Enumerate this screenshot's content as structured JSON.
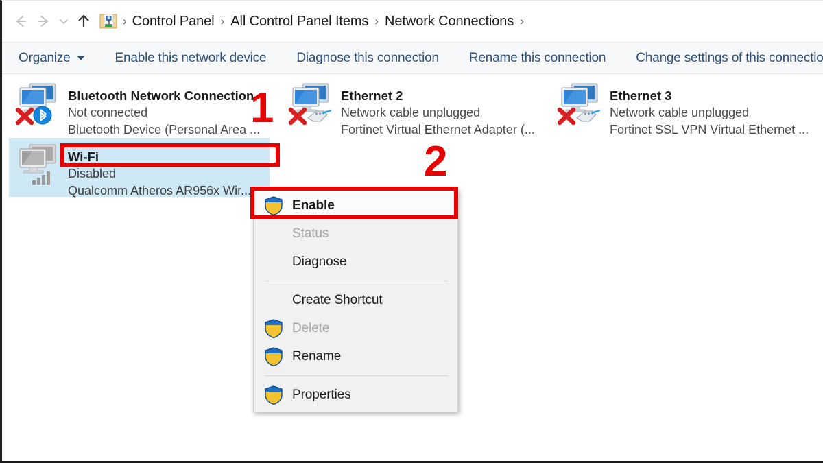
{
  "window": {
    "title": "Network Connections"
  },
  "addressbar": {
    "back_icon": "back-arrow-icon",
    "forward_icon": "forward-arrow-icon",
    "history_icon": "chevron-down-icon",
    "up_icon": "up-arrow-icon",
    "control_panel_icon": "control-panel-icon",
    "separator": "›",
    "crumbs": [
      {
        "label": "Control Panel"
      },
      {
        "label": "All Control Panel Items"
      },
      {
        "label": "Network Connections"
      }
    ]
  },
  "toolbar": {
    "items": [
      {
        "label": "Organize",
        "has_caret": true
      },
      {
        "label": "Enable this network device",
        "has_caret": false
      },
      {
        "label": "Diagnose this connection",
        "has_caret": false
      },
      {
        "label": "Rename this connection",
        "has_caret": false
      },
      {
        "label": "Change settings of this connection",
        "has_caret": false
      }
    ]
  },
  "connections": [
    {
      "name": "Bluetooth Network Connection",
      "status": "Not connected",
      "device": "Bluetooth Device (Personal Area ...",
      "icon": "network-adapter-icon",
      "badge": "bluetooth-icon",
      "overlay": "red-x-icon",
      "selected": false
    },
    {
      "name": "Ethernet 2",
      "status": "Network cable unplugged",
      "device": "Fortinet Virtual Ethernet Adapter (...",
      "icon": "network-adapter-icon",
      "badge": "ethernet-cable-icon",
      "overlay": "red-x-icon",
      "selected": false
    },
    {
      "name": "Ethernet 3",
      "status": "Network cable unplugged",
      "device": "Fortinet SSL VPN Virtual Ethernet ...",
      "icon": "network-adapter-icon",
      "badge": "ethernet-cable-icon",
      "overlay": "red-x-icon",
      "selected": false
    },
    {
      "name": "Wi-Fi",
      "status": "Disabled",
      "device": "Qualcomm Atheros AR956x Wir...",
      "icon": "network-adapter-disabled-icon",
      "badge": "wifi-signal-icon",
      "overlay": "",
      "selected": true
    }
  ],
  "context_menu": {
    "items": [
      {
        "label": "Enable",
        "shield": true,
        "disabled": false,
        "bold": true,
        "highlight": true,
        "separator_after": false
      },
      {
        "label": "Status",
        "shield": false,
        "disabled": true,
        "bold": false,
        "highlight": false,
        "separator_after": false
      },
      {
        "label": "Diagnose",
        "shield": false,
        "disabled": false,
        "bold": false,
        "highlight": false,
        "separator_after": true
      },
      {
        "label": "Create Shortcut",
        "shield": false,
        "disabled": false,
        "bold": false,
        "highlight": false,
        "separator_after": false
      },
      {
        "label": "Delete",
        "shield": true,
        "disabled": true,
        "bold": false,
        "highlight": false,
        "separator_after": false
      },
      {
        "label": "Rename",
        "shield": true,
        "disabled": false,
        "bold": false,
        "highlight": false,
        "separator_after": true
      },
      {
        "label": "Properties",
        "shield": true,
        "disabled": false,
        "bold": false,
        "highlight": false,
        "separator_after": false
      }
    ]
  },
  "annotations": {
    "accent_color": "#e60000",
    "steps": [
      {
        "number": "1",
        "target": "wi-fi-connection-item"
      },
      {
        "number": "2",
        "target": "enable-menu-item"
      }
    ]
  }
}
